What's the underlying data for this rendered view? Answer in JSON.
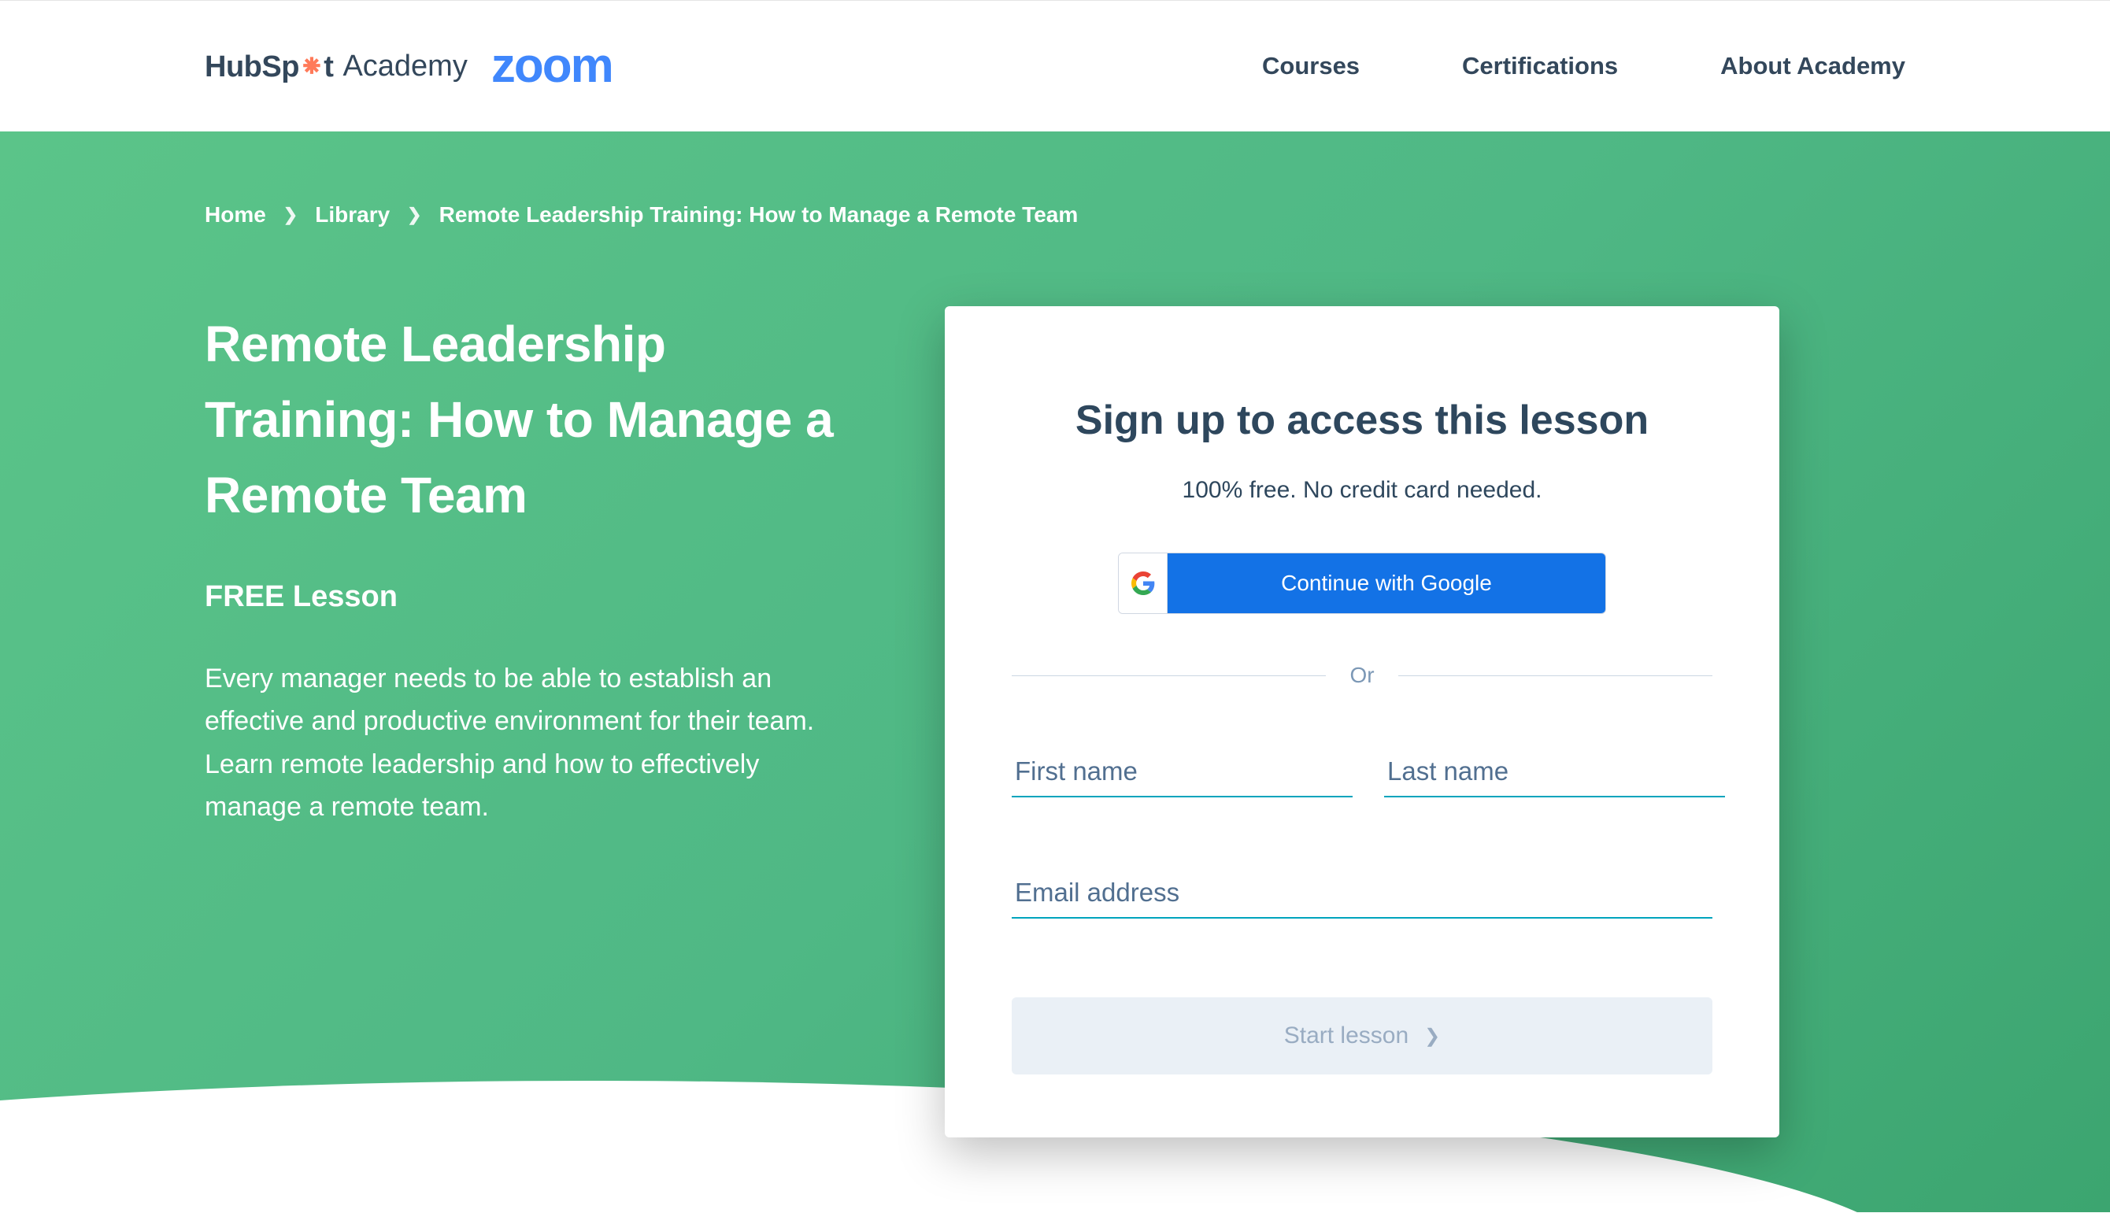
{
  "header": {
    "brand1_a": "HubSp",
    "brand1_b": "t",
    "brand1_academy": "Academy",
    "brand2": "zoom",
    "nav": [
      "Courses",
      "Certifications",
      "About Academy"
    ]
  },
  "breadcrumb": {
    "items": [
      "Home",
      "Library",
      "Remote Leadership Training: How to Manage a Remote Team"
    ]
  },
  "lesson": {
    "title": "Remote Leadership Training: How to Manage a Remote Team",
    "subtitle": "FREE Lesson",
    "description": "Every manager needs to be able to establish an effective and productive environment for their team. Learn remote leadership and how to effectively manage a remote team."
  },
  "signup": {
    "title": "Sign up to access this lesson",
    "subtitle": "100% free. No credit card needed.",
    "google_btn": "Continue with Google",
    "divider": "Or",
    "first_name_ph": "First name",
    "last_name_ph": "Last name",
    "email_ph": "Email address",
    "start_btn": "Start lesson"
  }
}
